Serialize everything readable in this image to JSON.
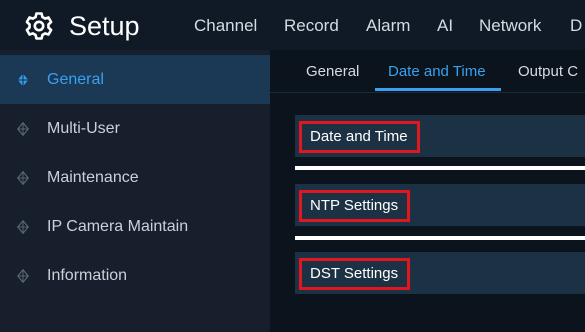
{
  "header": {
    "title": "Setup",
    "logo_icon": "gear-icon",
    "nav": [
      "Channel",
      "Record",
      "Alarm",
      "AI",
      "Network",
      "D"
    ]
  },
  "sidebar": {
    "items": [
      {
        "label": "General",
        "icon": "diamond-icon",
        "active": true
      },
      {
        "label": "Multi-User",
        "icon": "diamond-icon",
        "active": false
      },
      {
        "label": "Maintenance",
        "icon": "diamond-icon",
        "active": false
      },
      {
        "label": "IP Camera Maintain",
        "icon": "diamond-icon",
        "active": false
      },
      {
        "label": "Information",
        "icon": "diamond-icon",
        "active": false
      }
    ]
  },
  "tabs": [
    {
      "label": "General",
      "active": false
    },
    {
      "label": "Date and Time",
      "active": true
    },
    {
      "label": "Output C",
      "active": false
    }
  ],
  "sections": [
    {
      "label": "Date and Time"
    },
    {
      "label": "NTP Settings"
    },
    {
      "label": "DST Settings"
    }
  ],
  "colors": {
    "accent": "#3aa0f0",
    "highlight_box": "#e0171f",
    "active_sidebar_bg": "#1b3954",
    "section_bg": "#1d3145"
  }
}
